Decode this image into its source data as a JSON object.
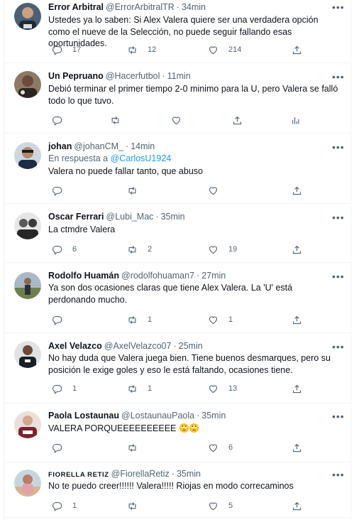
{
  "tweets": [
    {
      "name": "Error Arbitral",
      "handle": "@ErrorArbitralTR",
      "time": "34min",
      "reply_to_prefix": "",
      "reply_to_mention": "",
      "text": "Ustedes ya lo saben: Si Alex Valera quiere ser una verdadera opción como el nueve de la Selección, no puede seguir fallando esas oportunidades.",
      "replies": "17",
      "retweets": "12",
      "likes": "214",
      "avatar_color": "#5d6b7a"
    },
    {
      "name": "Un Pepruano",
      "handle": "@Hacerfutbol",
      "time": "11min",
      "reply_to_prefix": "",
      "reply_to_mention": "",
      "text": "Debió terminar el primer tiempo 2-0 minimo para la U, pero Valera se falló todo lo que tuvo.",
      "replies": "",
      "retweets": "",
      "likes": "",
      "avatar_color": "#8a6a52"
    },
    {
      "name": "johan",
      "handle": "@johanCM_",
      "time": "14min",
      "reply_to_prefix": "En respuesta a",
      "reply_to_mention": "@CarlosU1924",
      "text": "Valera no puede fallar tanto, que abuso",
      "replies": "",
      "retweets": "",
      "likes": "",
      "avatar_color": "#2d3a4d"
    },
    {
      "name": "Oscar Ferrari",
      "handle": "@Lubi_Mac",
      "time": "35min",
      "reply_to_prefix": "",
      "reply_to_mention": "",
      "text": "La ctmdre Valera",
      "replies": "6",
      "retweets": "2",
      "likes": "19",
      "avatar_color": "#3b3b3b"
    },
    {
      "name": "Rodolfo Huamán",
      "handle": "@rodolfohuaman7",
      "time": "27min",
      "reply_to_prefix": "",
      "reply_to_mention": "",
      "text": "Ya son dos ocasiones claras que tiene Alex Valera. La 'U' está perdonando mucho.",
      "replies": "",
      "retweets": "1",
      "likes": "1",
      "avatar_color": "#6b7c5a"
    },
    {
      "name": "Axel Velazco",
      "handle": "@AxelVelazco07",
      "time": "25min",
      "reply_to_prefix": "",
      "reply_to_mention": "",
      "text": "No hay duda que Valera juega bien. Tiene buenos desmarques, pero su posición le exige goles y eso le está faltando, ocasiones tiene.",
      "replies": "1",
      "retweets": "1",
      "likes": "13",
      "avatar_color": "#4a4f57"
    },
    {
      "name": "Paola Lostaunau",
      "handle": "@LostaunauPaola",
      "time": "35min",
      "reply_to_prefix": "",
      "reply_to_mention": "",
      "text": "VALERA PORQUEEEEEEEEEE",
      "replies": "",
      "retweets": "",
      "likes": "6",
      "avatar_color": "#7a2f3a"
    },
    {
      "name": "FIORELLA RETIZ",
      "handle": "@FiorellaRetiz",
      "time": "35min",
      "reply_to_prefix": "",
      "reply_to_mention": "",
      "text": "No te puedo creer!!!!!! Valera!!!!! Riojas en modo correcaminos",
      "replies": "1",
      "retweets": "",
      "likes": "5",
      "avatar_color": "#c98f86"
    }
  ],
  "icons": {
    "reply": "reply-icon",
    "retweet": "retweet-icon",
    "like": "heart-icon",
    "share": "share-icon",
    "analytics": "analytics-icon",
    "more": "more-icon",
    "emoji": "rolling-eyes-emoji"
  },
  "colors": {
    "text": "#0f1419",
    "secondary": "#536471",
    "link": "#1d9bf0",
    "border": "#eff3f4"
  }
}
